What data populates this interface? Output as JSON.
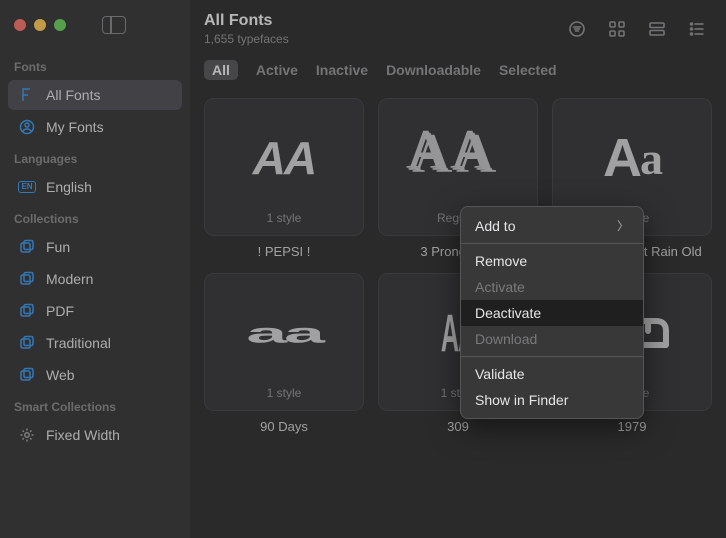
{
  "sidebar": {
    "sections": {
      "fonts": {
        "label": "Fonts",
        "items": [
          {
            "label": "All Fonts",
            "selected": true
          },
          {
            "label": "My Fonts"
          }
        ]
      },
      "languages": {
        "label": "Languages",
        "items": [
          {
            "label": "English"
          }
        ]
      },
      "collections": {
        "label": "Collections",
        "items": [
          {
            "label": "Fun"
          },
          {
            "label": "Modern"
          },
          {
            "label": "PDF"
          },
          {
            "label": "Traditional"
          },
          {
            "label": "Web"
          }
        ]
      },
      "smart": {
        "label": "Smart Collections",
        "items": [
          {
            "label": "Fixed Width"
          }
        ]
      }
    }
  },
  "header": {
    "title": "All Fonts",
    "subtitle": "1,655 typefaces"
  },
  "filters": [
    {
      "label": "All",
      "active": true
    },
    {
      "label": "Active"
    },
    {
      "label": "Inactive"
    },
    {
      "label": "Downloadable"
    },
    {
      "label": "Selected"
    }
  ],
  "fonts": [
    {
      "name": "! PEPSI !",
      "styles": "1 style"
    },
    {
      "name": "3 Prong Tree",
      "styles": "Regular"
    },
    {
      "name": "A Year Without Rain Old",
      "styles": "1 style"
    },
    {
      "name": "90 Days",
      "styles": "1 style"
    },
    {
      "name": "309",
      "styles": "1 style"
    },
    {
      "name": "1979",
      "styles": "1 style"
    }
  ],
  "context_menu": {
    "items": [
      {
        "label": "Add to",
        "submenu": true
      },
      {
        "sep": true
      },
      {
        "label": "Remove"
      },
      {
        "label": "Activate",
        "disabled": true
      },
      {
        "label": "Deactivate",
        "highlight": true
      },
      {
        "label": "Download",
        "disabled": true
      },
      {
        "sep": true
      },
      {
        "label": "Validate"
      },
      {
        "label": "Show in Finder"
      }
    ]
  }
}
